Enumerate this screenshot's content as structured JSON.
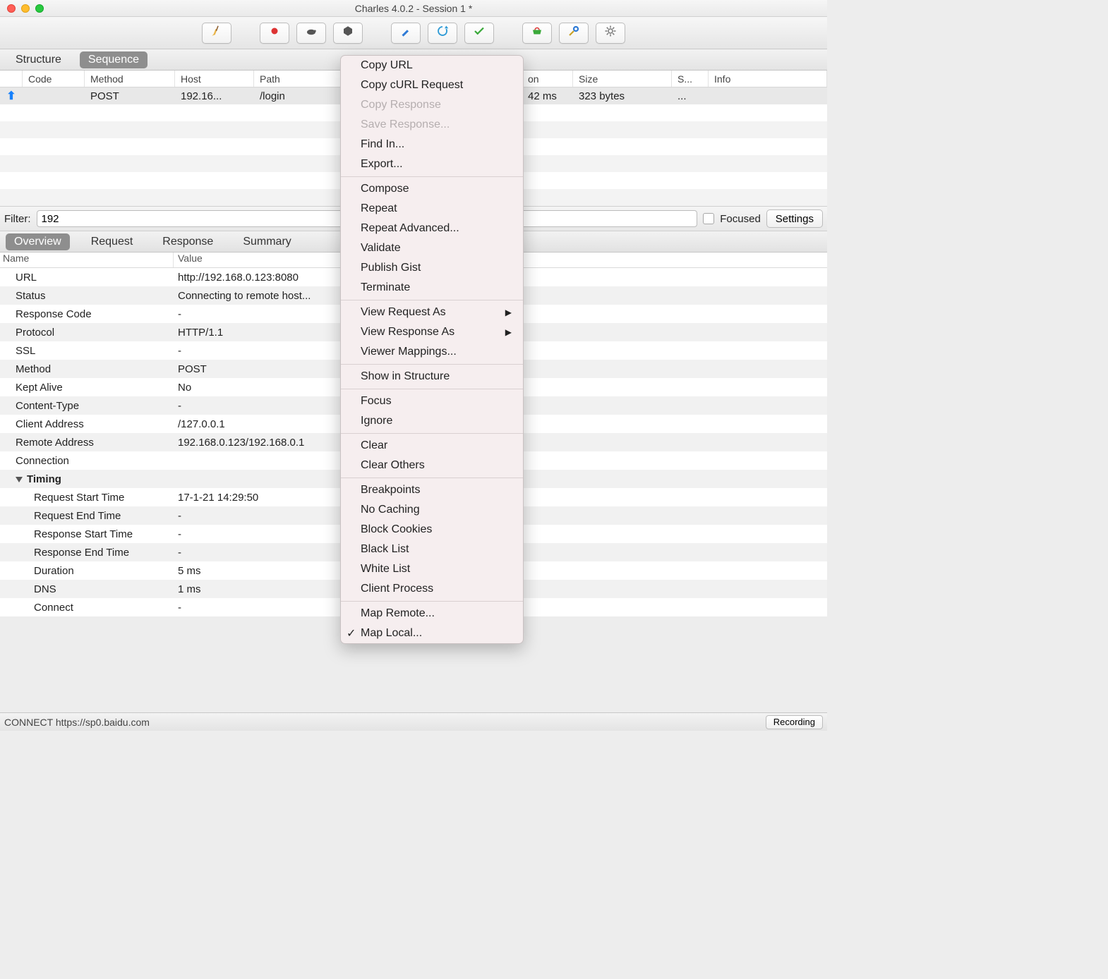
{
  "window": {
    "title": "Charles 4.0.2 - Session 1 *"
  },
  "toolbar_icons": [
    "broom",
    "record",
    "turtle",
    "hexagon",
    "pencil",
    "refresh",
    "check",
    "basket",
    "tools",
    "gear"
  ],
  "view_tabs": {
    "structure": "Structure",
    "sequence": "Sequence"
  },
  "columns": {
    "code": "Code",
    "method": "Method",
    "host": "Host",
    "path": "Path",
    "duration": "on",
    "size": "Size",
    "s": "S...",
    "info": "Info"
  },
  "rows": [
    {
      "code": "",
      "method": "POST",
      "host": "192.16...",
      "path": "/login",
      "duration": "42 ms",
      "size": "323 bytes",
      "s": "...",
      "info": ""
    }
  ],
  "filter": {
    "label": "Filter:",
    "value": "192",
    "focused": "Focused",
    "settings": "Settings"
  },
  "detail_tabs": {
    "overview": "Overview",
    "request": "Request",
    "response": "Response",
    "summary": "Summary"
  },
  "nv_header": {
    "name": "Name",
    "value": "Value"
  },
  "overview": [
    {
      "n": "URL",
      "v": "http://192.168.0.123:8080"
    },
    {
      "n": "Status",
      "v": "Connecting to remote host..."
    },
    {
      "n": "Response Code",
      "v": "-"
    },
    {
      "n": "Protocol",
      "v": "HTTP/1.1"
    },
    {
      "n": "SSL",
      "v": "-"
    },
    {
      "n": "Method",
      "v": "POST"
    },
    {
      "n": "Kept Alive",
      "v": "No"
    },
    {
      "n": "Content-Type",
      "v": "-"
    },
    {
      "n": "Client Address",
      "v": "/127.0.0.1"
    },
    {
      "n": "Remote Address",
      "v": "192.168.0.123/192.168.0.1"
    },
    {
      "n": "Connection",
      "v": ""
    }
  ],
  "timing_label": "Timing",
  "timing": [
    {
      "n": "Request Start Time",
      "v": "17-1-21 14:29:50"
    },
    {
      "n": "Request End Time",
      "v": "-"
    },
    {
      "n": "Response Start Time",
      "v": "-"
    },
    {
      "n": "Response End Time",
      "v": "-"
    },
    {
      "n": "Duration",
      "v": "5 ms"
    },
    {
      "n": "DNS",
      "v": "1 ms"
    },
    {
      "n": "Connect",
      "v": "-"
    }
  ],
  "status": {
    "text": "CONNECT https://sp0.baidu.com",
    "recording": "Recording"
  },
  "context_menu": {
    "g1": [
      "Copy URL",
      "Copy cURL Request"
    ],
    "g1d": [
      "Copy Response",
      "Save Response..."
    ],
    "g1b": [
      "Find In...",
      "Export..."
    ],
    "g2": [
      "Compose",
      "Repeat",
      "Repeat Advanced...",
      "Validate",
      "Publish Gist",
      "Terminate"
    ],
    "g3": [
      {
        "l": "View Request As",
        "sub": true
      },
      {
        "l": "View Response As",
        "sub": true
      },
      {
        "l": "Viewer Mappings..."
      }
    ],
    "g4": [
      "Show in Structure"
    ],
    "g5": [
      "Focus",
      "Ignore"
    ],
    "g6": [
      "Clear",
      "Clear Others"
    ],
    "g7": [
      "Breakpoints",
      "No Caching",
      "Block Cookies",
      "Black List",
      "White List",
      "Client Process"
    ],
    "g8": [
      {
        "l": "Map Remote..."
      },
      {
        "l": "Map Local...",
        "check": true
      }
    ]
  }
}
